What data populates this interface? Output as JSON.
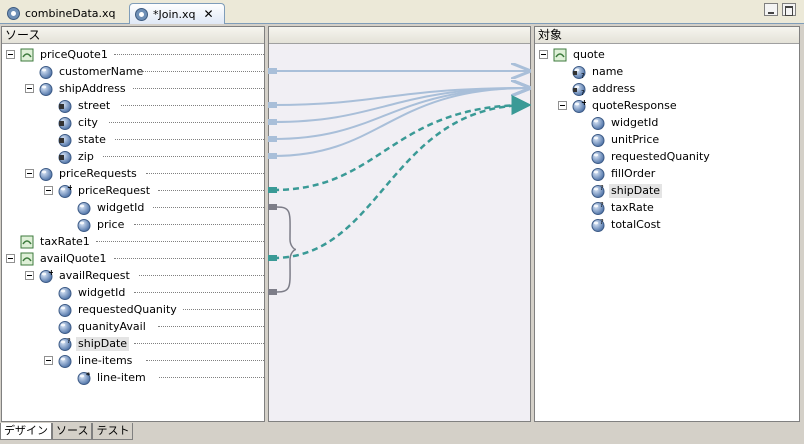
{
  "tabs": [
    {
      "label": "combineData.xq",
      "active": false
    },
    {
      "label": "*Join.xq",
      "active": true
    }
  ],
  "source": {
    "title": "ソース",
    "nodes": [
      {
        "id": "priceQuote1",
        "label": "priceQuote1",
        "icon": "schema-root-icon",
        "depth": 0,
        "expanded": true
      },
      {
        "id": "customerName",
        "label": "customerName",
        "icon": "element-icon",
        "depth": 1
      },
      {
        "id": "shipAddress",
        "label": "shipAddress",
        "icon": "element-icon",
        "depth": 1,
        "expanded": true
      },
      {
        "id": "street",
        "label": "street",
        "icon": "attribute-icon",
        "depth": 2
      },
      {
        "id": "city",
        "label": "city",
        "icon": "attribute-icon",
        "depth": 2
      },
      {
        "id": "state",
        "label": "state",
        "icon": "attribute-icon",
        "depth": 2
      },
      {
        "id": "zip",
        "label": "zip",
        "icon": "attribute-icon",
        "depth": 2
      },
      {
        "id": "priceRequests",
        "label": "priceRequests",
        "icon": "element-icon",
        "depth": 1,
        "expanded": true
      },
      {
        "id": "priceRequest",
        "label": "priceRequest",
        "icon": "repeating-element-icon",
        "depth": 2,
        "expanded": true
      },
      {
        "id": "widgetId_pr",
        "label": "widgetId",
        "icon": "element-icon",
        "depth": 3
      },
      {
        "id": "price",
        "label": "price",
        "icon": "element-icon",
        "depth": 3
      },
      {
        "id": "taxRate1",
        "label": "taxRate1",
        "icon": "schema-root-icon",
        "depth": 0
      },
      {
        "id": "availQuote1",
        "label": "availQuote1",
        "icon": "schema-root-icon",
        "depth": 0,
        "expanded": true
      },
      {
        "id": "availRequest",
        "label": "availRequest",
        "icon": "repeating-element-icon",
        "depth": 1,
        "expanded": true
      },
      {
        "id": "widgetId_av",
        "label": "widgetId",
        "icon": "element-icon",
        "depth": 2
      },
      {
        "id": "requestedQuanity",
        "label": "requestedQuanity",
        "icon": "element-icon",
        "depth": 2
      },
      {
        "id": "quanityAvail",
        "label": "quanityAvail",
        "icon": "element-icon",
        "depth": 2
      },
      {
        "id": "shipDate_src",
        "label": "shipDate",
        "icon": "optional-element-icon",
        "depth": 2,
        "selected": true
      },
      {
        "id": "lineItems",
        "label": "line-items",
        "icon": "element-icon",
        "depth": 2,
        "expanded": true
      },
      {
        "id": "lineItem",
        "label": "line-item",
        "icon": "repeating-any-element-icon",
        "depth": 3
      }
    ]
  },
  "middle": {
    "title": ""
  },
  "target": {
    "title": "対象",
    "nodes": [
      {
        "id": "quote",
        "label": "quote",
        "icon": "schema-root-icon",
        "depth": 0,
        "expanded": true
      },
      {
        "id": "name",
        "label": "name",
        "icon": "optional-attribute-icon",
        "depth": 1
      },
      {
        "id": "address",
        "label": "address",
        "icon": "optional-attribute-icon",
        "depth": 1
      },
      {
        "id": "quoteResponse",
        "label": "quoteResponse",
        "icon": "repeating-element-icon",
        "depth": 1,
        "expanded": true
      },
      {
        "id": "widgetId_t",
        "label": "widgetId",
        "icon": "element-icon",
        "depth": 2
      },
      {
        "id": "unitPrice",
        "label": "unitPrice",
        "icon": "element-icon",
        "depth": 2
      },
      {
        "id": "requestedQuanity_t",
        "label": "requestedQuanity",
        "icon": "element-icon",
        "depth": 2
      },
      {
        "id": "fillOrder",
        "label": "fillOrder",
        "icon": "element-icon",
        "depth": 2
      },
      {
        "id": "shipDate_t",
        "label": "shipDate",
        "icon": "optional-element-icon",
        "depth": 2,
        "selected": true
      },
      {
        "id": "taxRate",
        "label": "taxRate",
        "icon": "optional-element-icon",
        "depth": 2
      },
      {
        "id": "totalCost",
        "label": "totalCost",
        "icon": "optional-element-icon",
        "depth": 2
      }
    ]
  },
  "mappings": [
    {
      "from": "customerName",
      "to": "name",
      "style": "solid"
    },
    {
      "from": "street",
      "to": "address",
      "style": "solid"
    },
    {
      "from": "city",
      "to": "address",
      "style": "solid"
    },
    {
      "from": "state",
      "to": "address",
      "style": "solid"
    },
    {
      "from": "zip",
      "to": "address",
      "style": "solid"
    },
    {
      "from": "priceRequest",
      "to": "quoteResponse",
      "style": "dashed"
    },
    {
      "from": "availQuote1",
      "to": "quoteResponse",
      "style": "dashed"
    }
  ],
  "joins": [
    {
      "from": "widgetId_pr",
      "to": "widgetId_av"
    }
  ],
  "colors": {
    "solid_link": "#a9bfd9",
    "dashed_link": "#3a9a96",
    "join": "#7d7d88"
  },
  "bottom_tabs": [
    {
      "label": "デザイン",
      "active": true
    },
    {
      "label": "ソース",
      "active": false
    },
    {
      "label": "テスト",
      "active": false
    }
  ]
}
